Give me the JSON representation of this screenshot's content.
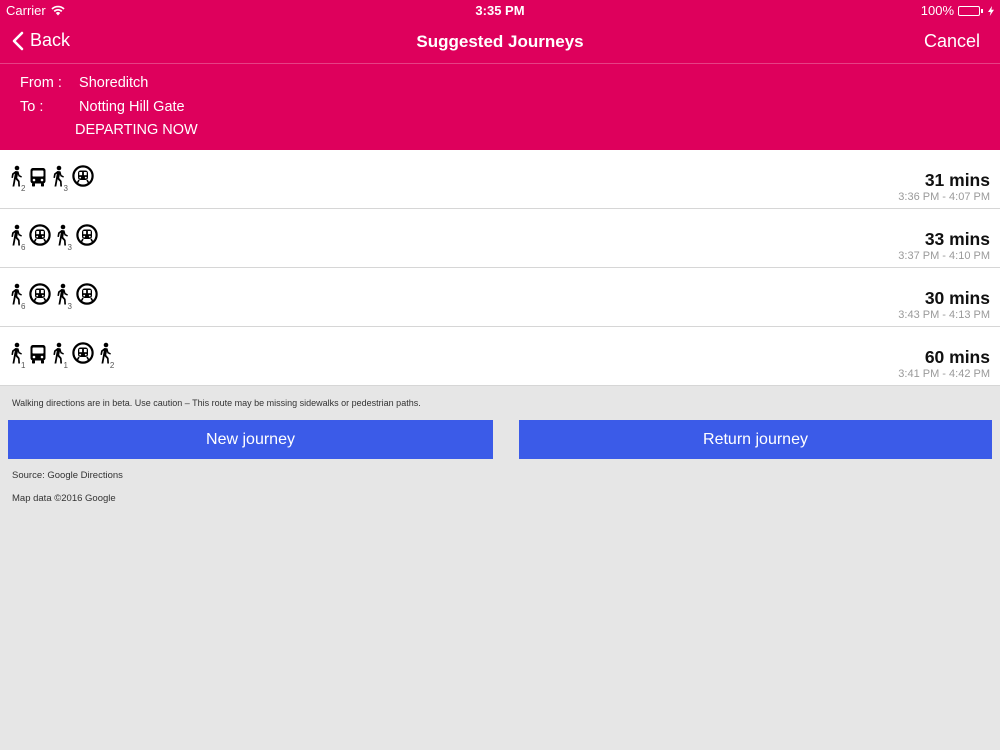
{
  "status": {
    "carrier": "Carrier",
    "time": "3:35 PM",
    "battery": "100%",
    "battery_fraction": 1.0,
    "battery_color": "#4cd964"
  },
  "nav": {
    "back": "Back",
    "title": "Suggested Journeys",
    "cancel": "Cancel"
  },
  "journey": {
    "from_label": "From :",
    "from_value": "Shoreditch",
    "to_label": "To :",
    "to_value": "Notting Hill Gate",
    "departure": "DEPARTING NOW"
  },
  "routes": [
    {
      "segments": [
        {
          "icon": "walk-icon",
          "num": "2"
        },
        {
          "icon": "bus-icon",
          "num": ""
        },
        {
          "icon": "walk-icon",
          "num": "3"
        },
        {
          "icon": "tube-icon",
          "num": ""
        }
      ],
      "duration": "31 mins",
      "range": "3:36 PM - 4:07 PM"
    },
    {
      "segments": [
        {
          "icon": "walk-icon",
          "num": "6"
        },
        {
          "icon": "tube-icon",
          "num": ""
        },
        {
          "icon": "walk-icon",
          "num": "3"
        },
        {
          "icon": "tube-icon",
          "num": ""
        }
      ],
      "duration": "33 mins",
      "range": "3:37 PM - 4:10 PM"
    },
    {
      "segments": [
        {
          "icon": "walk-icon",
          "num": "6"
        },
        {
          "icon": "tube-icon",
          "num": ""
        },
        {
          "icon": "walk-icon",
          "num": "3"
        },
        {
          "icon": "tube-icon",
          "num": ""
        }
      ],
      "duration": "30 mins",
      "range": "3:43 PM - 4:13 PM"
    },
    {
      "segments": [
        {
          "icon": "walk-icon",
          "num": "1"
        },
        {
          "icon": "bus-icon",
          "num": ""
        },
        {
          "icon": "walk-icon",
          "num": "1"
        },
        {
          "icon": "tube-icon",
          "num": ""
        },
        {
          "icon": "walk-icon",
          "num": "2"
        }
      ],
      "duration": "60 mins",
      "range": "3:41 PM - 4:42 PM"
    }
  ],
  "disclaimer": "Walking directions are in beta. Use caution – This route may be missing sidewalks or pedestrian paths.",
  "buttons": {
    "new": "New journey",
    "return": "Return journey"
  },
  "footer": {
    "source": "Source: Google Directions",
    "map_data": "Map data ©2016 Google"
  },
  "colors": {
    "brand": "#de005c",
    "button": "#3b5be8",
    "background": "#e6e6e6"
  }
}
